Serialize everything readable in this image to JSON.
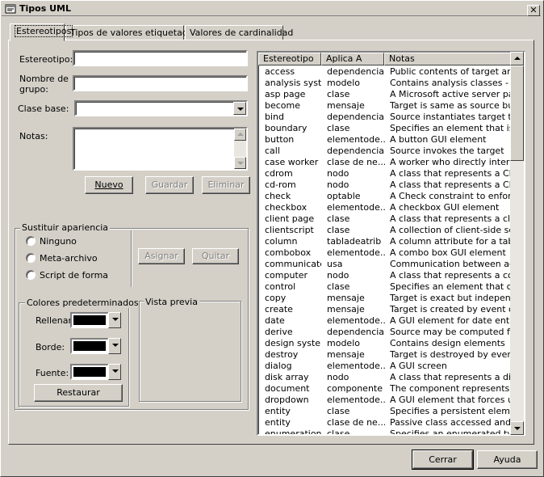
{
  "window": {
    "title": "Tipos UML",
    "close_glyph": "✕"
  },
  "tabs": [
    {
      "label": "Estereotipos"
    },
    {
      "label": "Tipos de valores etiquetados"
    },
    {
      "label": "Valores de cardinalidad"
    }
  ],
  "form": {
    "stereotype_label": "Estereotipo:",
    "stereotype_value": "",
    "group_name_label_1": "Nombre de",
    "group_name_label_2": "grupo:",
    "group_name_value": "",
    "base_class_label": "Clase base:",
    "base_class_value": "",
    "notes_label": "Notas:",
    "notes_value": ""
  },
  "buttons": {
    "new": "Nuevo",
    "save": "Guardar",
    "delete": "Eliminar",
    "assign": "Asignar",
    "remove": "Quitar",
    "restore": "Restaurar",
    "close": "Cerrar",
    "help": "Ayuda"
  },
  "appearance": {
    "title": "Sustituir apariencia",
    "options": [
      "Ninguno",
      "Meta-archivo",
      "Script de forma"
    ]
  },
  "colors": {
    "title": "Colores predeterminados",
    "fill_label": "Rellenar:",
    "border_label": "Borde:",
    "font_label": "Fuente:",
    "fill_color": "#000000",
    "border_color": "#000000",
    "font_color": "#000000"
  },
  "preview": {
    "title": "Vista previa"
  },
  "list": {
    "columns": [
      "Estereotipo",
      "Aplica A",
      "Notas"
    ],
    "rows": [
      [
        "access",
        "dependencia",
        "Public contents of target are ..."
      ],
      [
        "analysis syst...",
        "modelo",
        "Contains analysis classes - e..."
      ],
      [
        "asp page",
        "clase",
        "A Microsoft active server page"
      ],
      [
        "become",
        "mensaje",
        "Target is same as source but..."
      ],
      [
        "bind",
        "dependencia",
        "Source instantiates target te..."
      ],
      [
        "boundary",
        "clase",
        "Specifies an element that is ..."
      ],
      [
        "button",
        "elementode...",
        "A button GUI element"
      ],
      [
        "call",
        "dependencia",
        "Source invokes the target"
      ],
      [
        "case worker",
        "clase de ne...",
        "A worker who directly interac..."
      ],
      [
        "cdrom",
        "nodo",
        "A class that represents a CD..."
      ],
      [
        "cd-rom",
        "nodo",
        "A class that represents a CD..."
      ],
      [
        "check",
        "optable",
        "A Check constraint to enforc..."
      ],
      [
        "checkbox",
        "elementode...",
        "A checkbox GUI element"
      ],
      [
        "client page",
        "clase",
        "A class that represents a clie..."
      ],
      [
        "clientscript",
        "clase",
        "A collection of client-side scri..."
      ],
      [
        "column",
        "tabladeatrib",
        "A column attribute for a table"
      ],
      [
        "combobox",
        "elementode...",
        "A combo box GUI element"
      ],
      [
        "communicate",
        "usa",
        "Communication between act..."
      ],
      [
        "computer",
        "nodo",
        "A class that represents a co..."
      ],
      [
        "control",
        "clase",
        "Specifies an element that co..."
      ],
      [
        "copy",
        "mensaje",
        "Target is exact but independ..."
      ],
      [
        "create",
        "mensaje",
        "Target is created by event or..."
      ],
      [
        "date",
        "elementode...",
        "A GUI element for date entry"
      ],
      [
        "derive",
        "dependencia",
        "Source may be computed fro..."
      ],
      [
        "design system",
        "modelo",
        "Contains design elements"
      ],
      [
        "destroy",
        "mensaje",
        "Target is destroyed by event..."
      ],
      [
        "dialog",
        "elementode...",
        "A GUI screen"
      ],
      [
        "disk array",
        "nodo",
        "A class that represents a dis..."
      ],
      [
        "document",
        "componente",
        "The component represents a..."
      ],
      [
        "dropdown",
        "elementode...",
        "A GUI element that forces us..."
      ],
      [
        "entity",
        "clase",
        "Specifies a persistent eleme..."
      ],
      [
        "entity",
        "clase de ne...",
        "Passive class accessed and..."
      ],
      [
        "enumeration",
        "clase",
        "Specifies an enumerated type..."
      ]
    ]
  }
}
